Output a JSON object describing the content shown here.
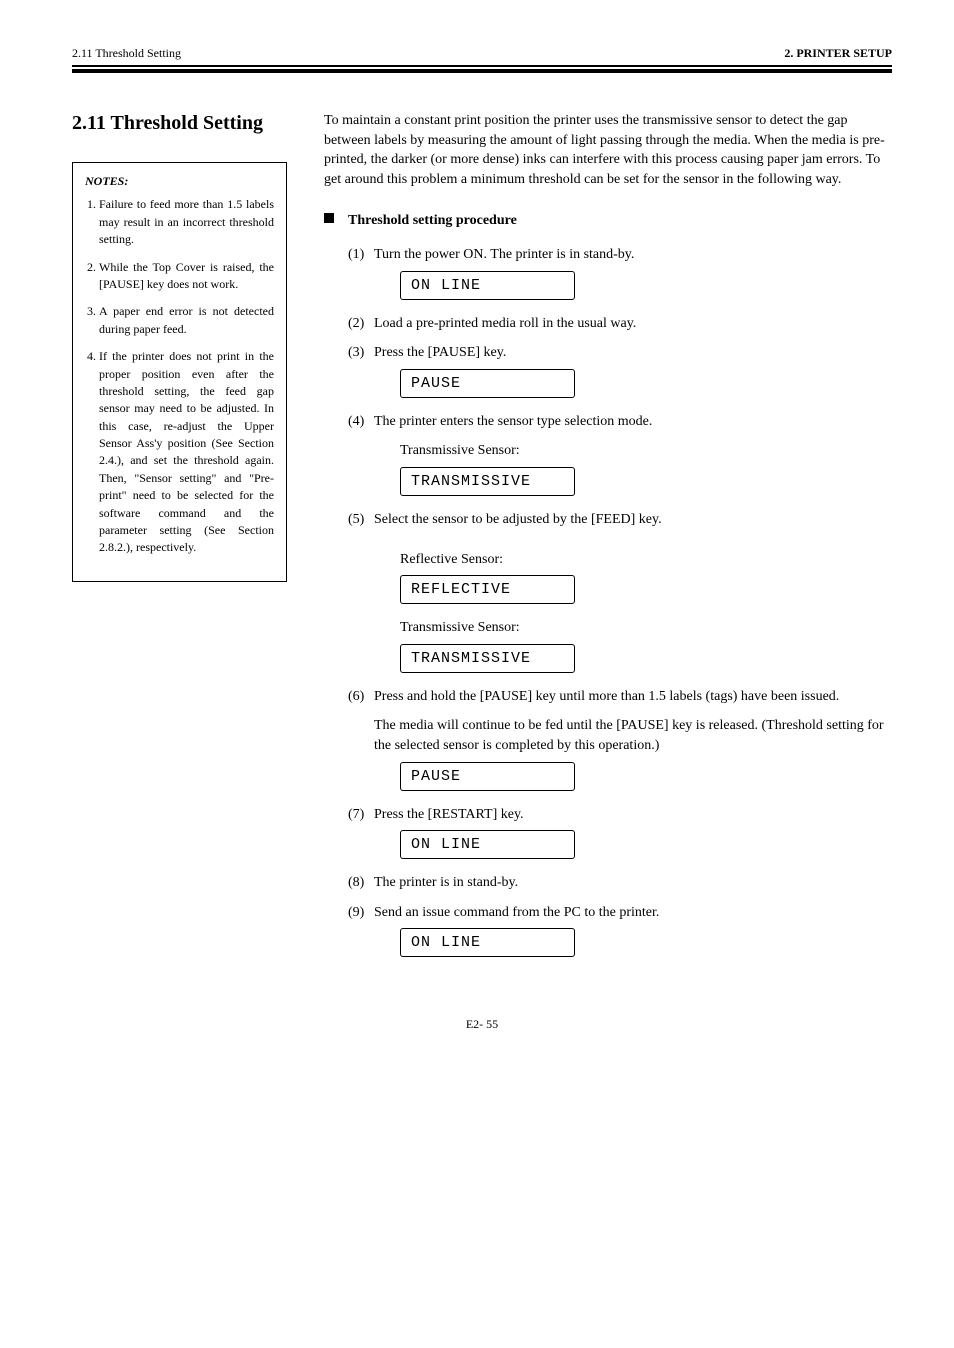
{
  "header": {
    "left": "2.11 Threshold Setting",
    "right": "2. PRINTER SETUP"
  },
  "left": {
    "heading": "2.11 Threshold Setting",
    "note_title": "NOTES:",
    "notes": [
      "Failure to feed more than 1.5 labels may result in an incorrect threshold setting.",
      "While the Top Cover is raised, the [PAUSE] key does not work.",
      "A paper end error is not detected during paper feed.",
      "If the printer does not print in the proper position even after the threshold setting, the feed gap sensor may need to be adjusted. In this case, re-adjust the Upper Sensor Ass'y position (See Section 2.4.), and set the threshold again. Then, \"Sensor setting\" and \"Pre-print\" need to be selected for the software command and the parameter setting (See Section 2.8.2.), respectively."
    ]
  },
  "right": {
    "intro": "To maintain a constant print position the printer uses the transmissive sensor to detect the gap between labels by measuring the amount of light passing through the media. When the media is pre-printed, the darker (or more dense) inks can interfere with this process causing paper jam errors. To get around this problem a minimum threshold can be set for the sensor in the following way.",
    "proc_title": "Threshold setting procedure",
    "steps": {
      "s1": {
        "num": "(1)",
        "text": "Turn the power ON. The printer is in stand-by."
      },
      "s2": {
        "num": "(2)",
        "text": "Load a pre-printed media roll in the usual way."
      },
      "s3": {
        "num": "(3)",
        "text": "Press the [PAUSE] key."
      },
      "s4": {
        "num": "(4)",
        "text": "The printer enters the sensor type selection mode."
      },
      "s5": {
        "num": "(5)",
        "text": "Select the sensor to be adjusted by the [FEED] key."
      },
      "s6": {
        "num": "(6)",
        "text": "Press and hold the [PAUSE] key until more than 1.5 labels (tags) have been issued."
      },
      "s6b": "The media will continue to be fed until the [PAUSE] key is released. (Threshold setting for the selected sensor is completed by this operation.)",
      "s7": {
        "num": "(7)",
        "text": "Press the [RESTART] key."
      },
      "s8": {
        "num": "(8)",
        "text": "The printer is in stand-by."
      },
      "s9": {
        "num": "(9)",
        "text": "Send an issue command from the PC to the printer."
      }
    },
    "sensor_labels": {
      "transmissive": "Transmissive Sensor:",
      "reflective": "Reflective Sensor:"
    },
    "lcd": {
      "online": "ON LINE",
      "pause": "PAUSE",
      "transmissive": "TRANSMISSIVE",
      "reflective": "REFLECTIVE"
    }
  },
  "footer": {
    "page": "E2- 55"
  }
}
